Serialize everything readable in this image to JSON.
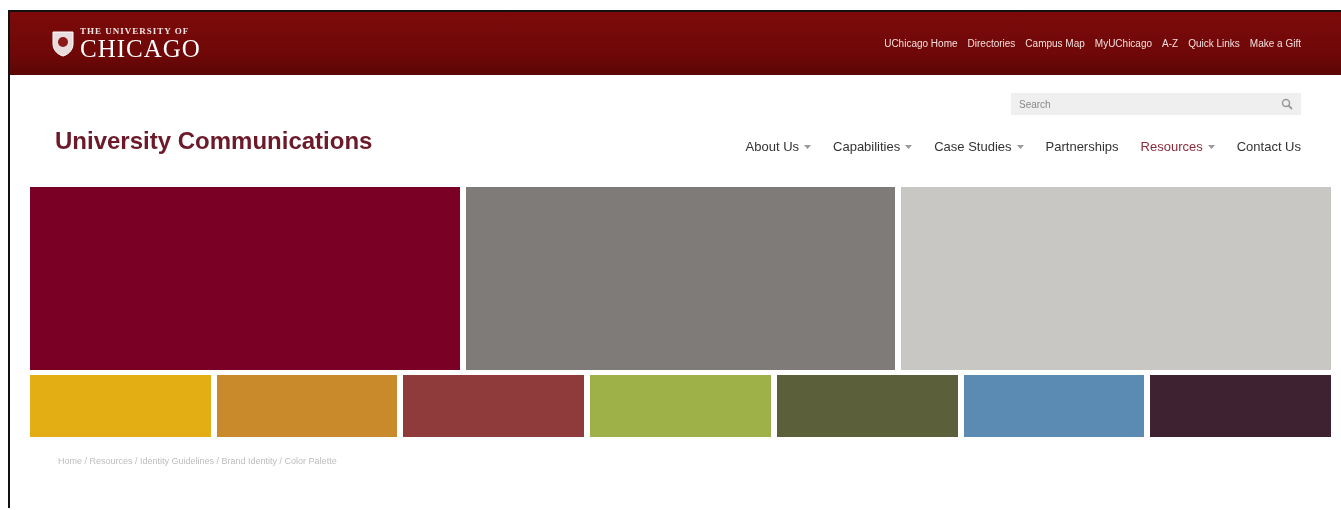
{
  "brand": {
    "line_1": "THE UNIVERSITY OF",
    "line_2": "CHICAGO"
  },
  "utility_links": [
    "UChicago Home",
    "Directories",
    "Campus Map",
    "MyUChicago",
    "A-Z",
    "Quick Links",
    "Make a Gift"
  ],
  "site_title": "University Communications",
  "search": {
    "placeholder": "Search"
  },
  "nav": [
    {
      "label": "About Us",
      "has_menu": true,
      "selected": false
    },
    {
      "label": "Capabilities",
      "has_menu": true,
      "selected": false
    },
    {
      "label": "Case Studies",
      "has_menu": true,
      "selected": false
    },
    {
      "label": "Partnerships",
      "has_menu": false,
      "selected": false
    },
    {
      "label": "Resources",
      "has_menu": true,
      "selected": true
    },
    {
      "label": "Contact Us",
      "has_menu": false,
      "selected": false
    }
  ],
  "primary_swatches": [
    {
      "color": "#7a0025"
    },
    {
      "color": "#7f7b78"
    },
    {
      "color": "#c9c7c4"
    }
  ],
  "secondary_swatches": [
    {
      "color": "#e3ae14"
    },
    {
      "color": "#c98a2c"
    },
    {
      "color": "#8f3b3c"
    },
    {
      "color": "#9eb048"
    },
    {
      "color": "#5b603b"
    },
    {
      "color": "#5b8bb2"
    },
    {
      "color": "#3e2232"
    }
  ],
  "breadcrumb": "Home / Resources / Identity Guidelines / Brand Identity / Color Palette"
}
